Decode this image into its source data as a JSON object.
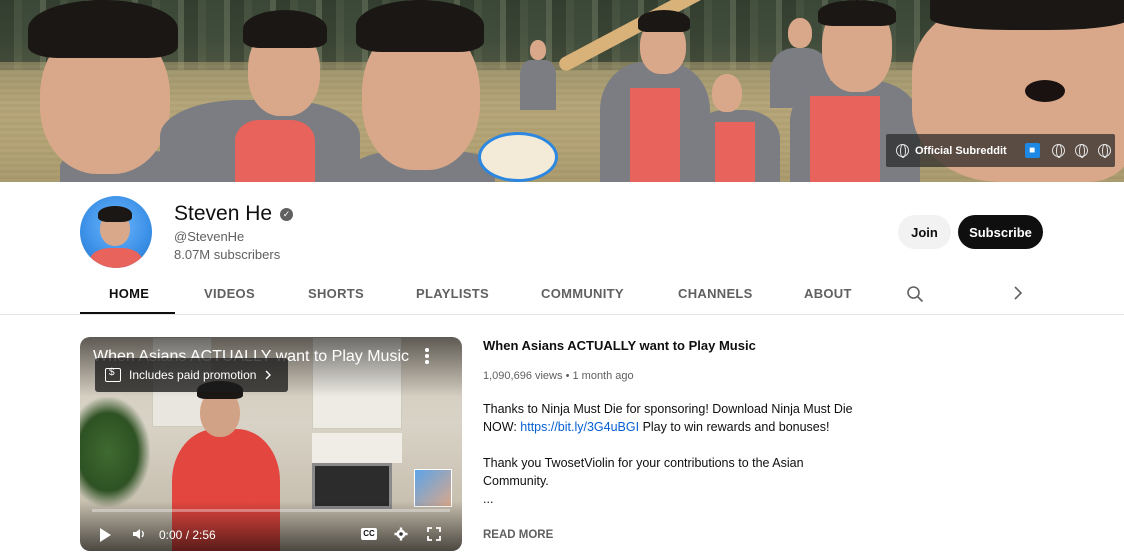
{
  "banner": {
    "links": {
      "primary_label": "Official Subreddit",
      "icons": [
        "globe-icon",
        "cart-icon",
        "globe-icon",
        "globe-icon",
        "globe-icon"
      ]
    }
  },
  "channel": {
    "name": "Steven He",
    "verified_icon": "check-circle-icon",
    "handle": "@StevenHe",
    "subscribers": "8.07M subscribers",
    "join_label": "Join",
    "subscribe_label": "Subscribe"
  },
  "tabs": {
    "items": [
      {
        "label": "HOME",
        "active": true
      },
      {
        "label": "VIDEOS",
        "active": false
      },
      {
        "label": "SHORTS",
        "active": false
      },
      {
        "label": "PLAYLISTS",
        "active": false
      },
      {
        "label": "COMMUNITY",
        "active": false
      },
      {
        "label": "CHANNELS",
        "active": false
      },
      {
        "label": "ABOUT",
        "active": false
      }
    ],
    "search_icon": "search-icon",
    "next_icon": "chevron-right-icon"
  },
  "featured_video": {
    "player": {
      "title": "When Asians ACTUALLY want to Play Music",
      "promo_label": "Includes paid promotion",
      "time": "0:00 / 2:56",
      "cc_label": "CC"
    },
    "title": "When Asians ACTUALLY want to Play Music",
    "views": "1,090,696 views",
    "separator": "•",
    "age": "1 month ago",
    "description": {
      "line1": "Thanks to Ninja Must Die for sponsoring! Download Ninja Must Die NOW: ",
      "link": "https://bit.ly/3G4uBGI",
      "line1_end": "  Play to win rewards and bonuses!",
      "line2": "Thank you TwosetViolin for your contributions to the Asian Community.",
      "ellipsis": "..."
    },
    "read_more": "READ MORE"
  },
  "colors": {
    "subscribe_bg": "#0f0f0f",
    "link": "#065fd4",
    "secondary_text": "#606060",
    "cart_badge": "#1e88e5"
  }
}
